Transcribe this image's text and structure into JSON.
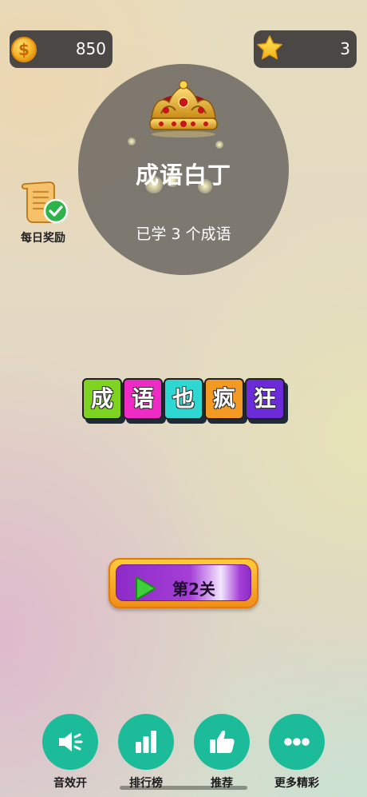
{
  "header": {
    "coins": "850",
    "stars": "3",
    "coin_symbol": "$"
  },
  "profile": {
    "rank_title": "成语白丁",
    "learned_text": "已学 3 个成语"
  },
  "daily_reward": {
    "label": "每日奖励"
  },
  "logo": {
    "tiles": [
      {
        "char": "成",
        "color": "#7ed321"
      },
      {
        "char": "语",
        "color": "#ee2bc4"
      },
      {
        "char": "也",
        "color": "#2fd7d3"
      },
      {
        "char": "疯",
        "color": "#f39a25"
      },
      {
        "char": "狂",
        "color": "#6b2bd8"
      }
    ]
  },
  "level_button": {
    "label": "第2关"
  },
  "bottom_nav": [
    {
      "id": "sound",
      "label": "音效开",
      "icon": "speaker-icon"
    },
    {
      "id": "ranking",
      "label": "排行榜",
      "icon": "bar-chart-icon"
    },
    {
      "id": "recommend",
      "label": "推荐",
      "icon": "thumbs-up-icon"
    },
    {
      "id": "more",
      "label": "更多精彩",
      "icon": "more-dots-icon"
    }
  ],
  "colors": {
    "accent_green": "#1cbc9b",
    "pill_bg": "#4a4744",
    "button_purple": "#9b36d2",
    "button_gold": "#f5a623"
  }
}
